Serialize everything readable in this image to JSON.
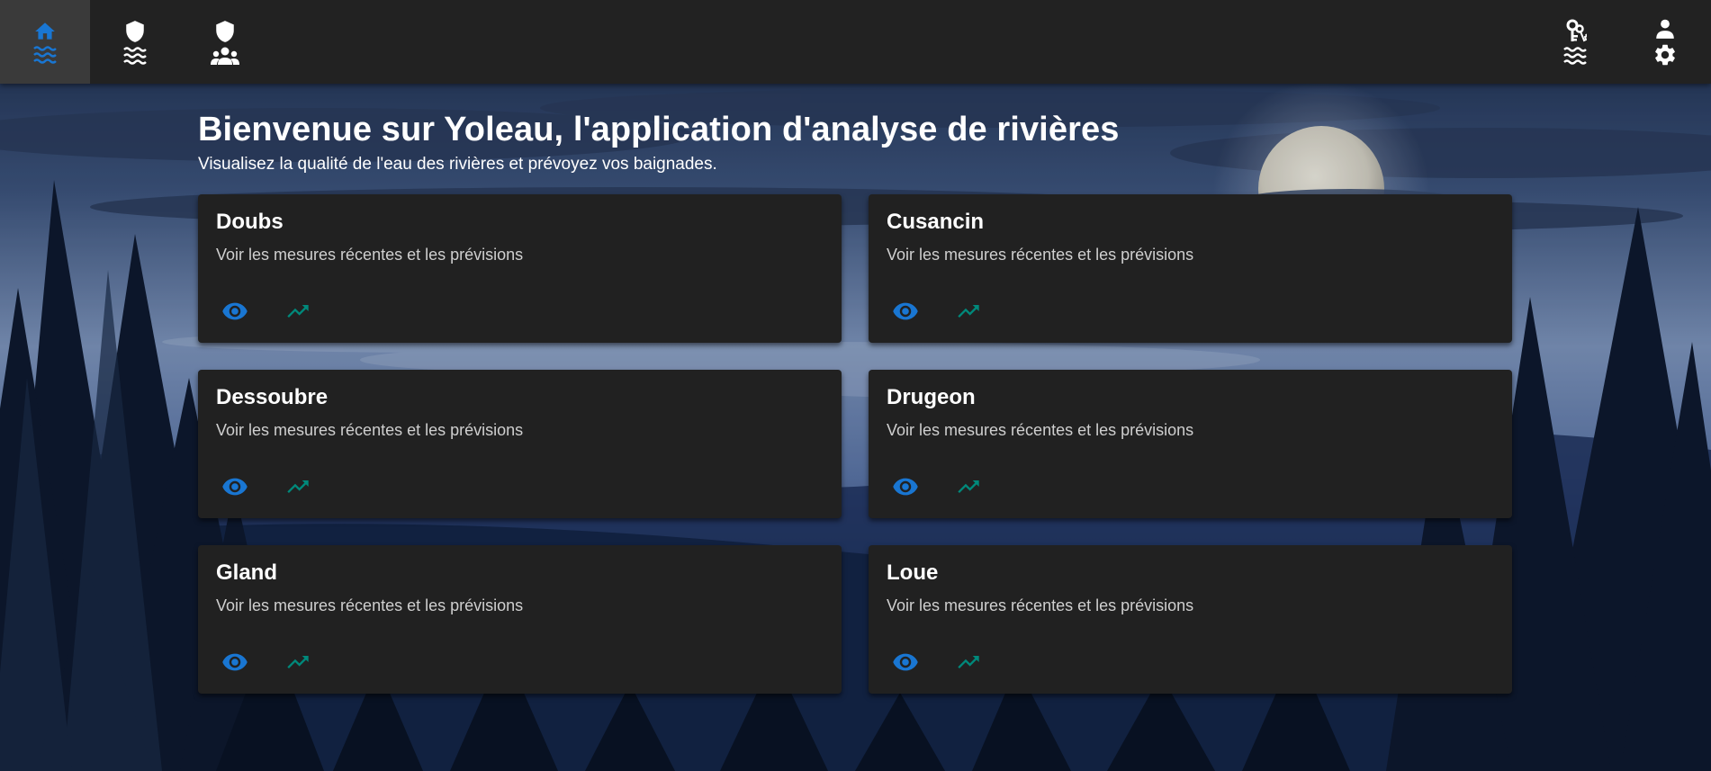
{
  "colors": {
    "topbar": "#222222",
    "active_nav": "#3a3a3a",
    "accent_blue": "#1976d2",
    "accent_teal": "#00897b",
    "card_bg": "#212121"
  },
  "nav": {
    "left": [
      {
        "name": "home-rivers",
        "icons": [
          "home-icon",
          "waves-icon"
        ],
        "active": true
      },
      {
        "name": "admin-rivers",
        "icons": [
          "shield-icon",
          "waves-icon"
        ],
        "active": false
      },
      {
        "name": "admin-users",
        "icons": [
          "shield-icon",
          "group-icon"
        ],
        "active": false
      }
    ],
    "right": [
      {
        "name": "river-access",
        "icons": [
          "keys-icon",
          "waves-icon"
        ]
      },
      {
        "name": "user-settings",
        "icons": [
          "person-icon",
          "gear-icon"
        ]
      }
    ]
  },
  "header": {
    "title": "Bienvenue sur Yoleau, l'application d'analyse de rivières",
    "subtitle": "Visualisez la qualité de l'eau des rivières et prévoyez vos baignades."
  },
  "rivers": [
    {
      "name": "Doubs",
      "description": "Voir les mesures récentes et les prévisions",
      "actions": [
        "eye-icon",
        "trending-up-icon"
      ]
    },
    {
      "name": "Cusancin",
      "description": "Voir les mesures récentes et les prévisions",
      "actions": [
        "eye-icon",
        "trending-up-icon"
      ]
    },
    {
      "name": "Dessoubre",
      "description": "Voir les mesures récentes et les prévisions",
      "actions": [
        "eye-icon",
        "trending-up-icon"
      ]
    },
    {
      "name": "Drugeon",
      "description": "Voir les mesures récentes et les prévisions",
      "actions": [
        "eye-icon",
        "trending-up-icon"
      ]
    },
    {
      "name": "Gland",
      "description": "Voir les mesures récentes et les prévisions",
      "actions": [
        "eye-icon",
        "trending-up-icon"
      ]
    },
    {
      "name": "Loue",
      "description": "Voir les mesures récentes et les prévisions",
      "actions": [
        "eye-icon",
        "trending-up-icon"
      ]
    }
  ]
}
